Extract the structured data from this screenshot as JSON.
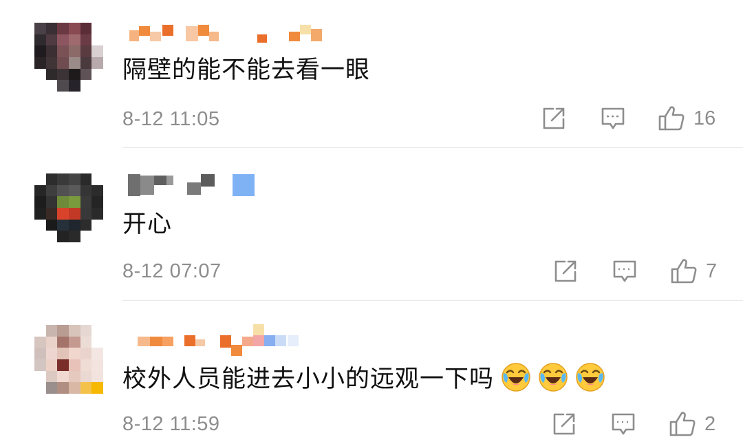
{
  "comments": [
    {
      "text": "隔壁的能不能去看一眼",
      "timestamp": "8-12 11:05",
      "like_count": "16",
      "emojis": []
    },
    {
      "text": "开心",
      "timestamp": "8-12 07:07",
      "like_count": "7",
      "emojis": []
    },
    {
      "text": "校外人员能进去小小的远观一下吗",
      "timestamp": "8-12 11:59",
      "like_count": "2",
      "emojis": [
        "crying-laughing-emoji",
        "crying-laughing-emoji",
        "crying-laughing-emoji"
      ]
    }
  ],
  "icons": {
    "share": "share-icon",
    "comment": "comment-icon",
    "like": "like-icon"
  },
  "colors": {
    "text": "#111111",
    "meta_text": "#8d8d8d",
    "icon_stroke": "#8d8d8d",
    "divider": "#e9e9e9",
    "username_blur_orange": "#f08a3c",
    "username_blur_gray": "#6f6f6f",
    "verified_badge_blue": "#7fb2f5"
  }
}
